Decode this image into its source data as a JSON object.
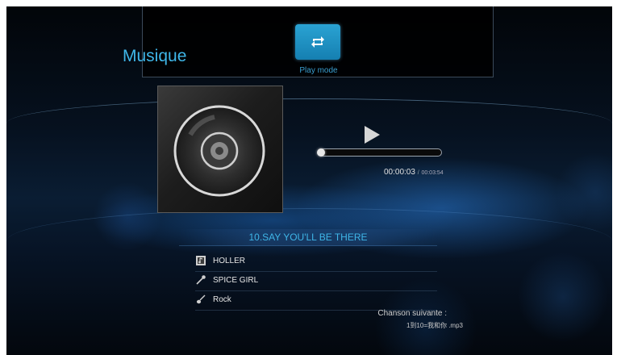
{
  "header": {
    "title": "Musique",
    "play_mode_label": "Play mode"
  },
  "player": {
    "state": "play",
    "elapsed": "00:00:03",
    "separator": "/",
    "total": "00:03:54",
    "progress_fraction": 0.013
  },
  "track": {
    "title": "10.SAY YOU'LL BE THERE",
    "album": "HOLLER",
    "artist": "SPICE GIRL",
    "genre": "Rock"
  },
  "next": {
    "label": "Chanson suivante :",
    "file": "1到10=我和你 .mp3"
  },
  "icons": {
    "play_mode": "repeat-icon",
    "album": "album-icon",
    "artist": "microphone-icon",
    "genre": "guitar-icon",
    "play": "play-icon",
    "cover": "cd-disc-icon"
  },
  "colors": {
    "accent": "#3fb6e8",
    "button": "#1f95c8",
    "text": "#e6e6e6"
  }
}
